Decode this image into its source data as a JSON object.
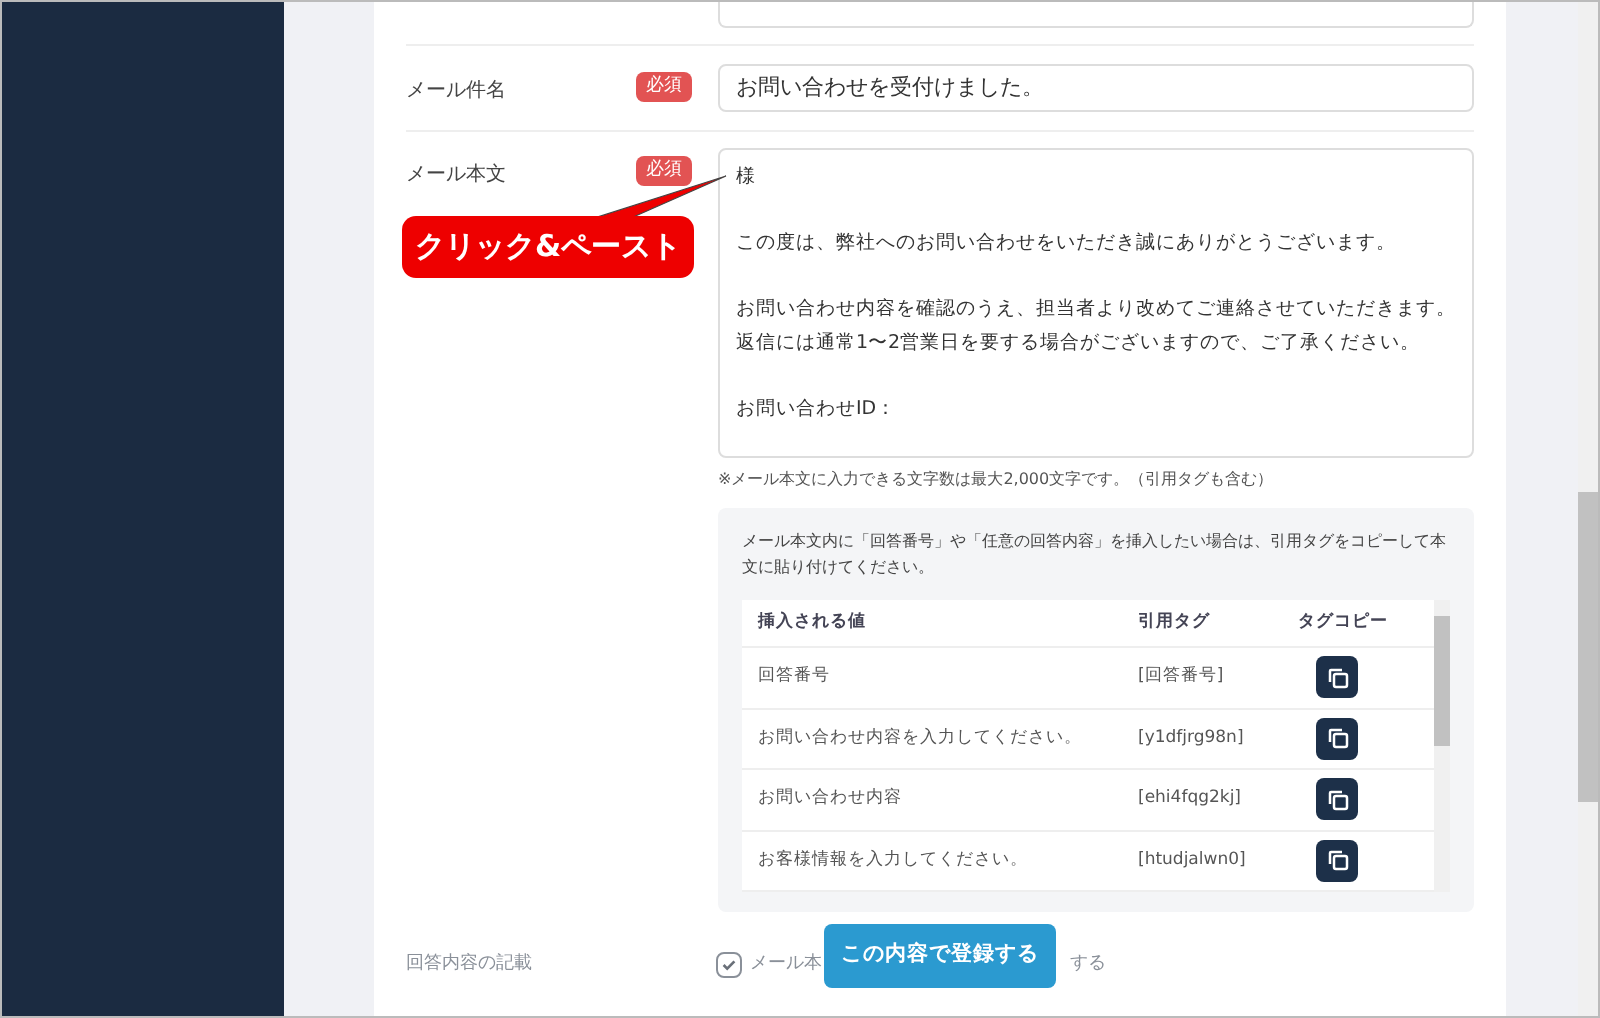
{
  "form": {
    "rows": [
      {
        "label": "メール件名",
        "badge": "必須",
        "kind": "input",
        "value": "お問い合わせを受付けました。"
      },
      {
        "label": "メール本文",
        "badge": "必須",
        "kind": "textarea",
        "paragraphs": [
          [
            "様"
          ],
          [
            "この度は、弊社へのお問い合わせをいただき誠にありがとうございます。"
          ],
          [
            "お問い合わせ内容を確認のうえ、担当者より改めてご連絡させていただきます。",
            "返信には通常1〜2営業日を要する場合がございますので、ご了承ください。"
          ],
          [
            "お問い合わせID："
          ]
        ],
        "note": "※メール本文に入力できる文字数は最大2,000文字です。（引用タグも含む）"
      }
    ]
  },
  "callout": "クリック&ペースト",
  "tag_panel": {
    "description": "メール本文内に「回答番号」や「任意の回答内容」を挿入したい場合は、引用タグをコピーして本文に貼り付けてください。",
    "columns": [
      "挿入される値",
      "引用タグ",
      "タグコピー"
    ],
    "rows": [
      {
        "value": "回答番号",
        "tag": "[回答番号]"
      },
      {
        "value": "お問い合わせ内容を入力してください。",
        "tag": "[y1dfjrg98n]"
      },
      {
        "value": "お問い合わせ内容",
        "tag": "[ehi4fqg2kj]"
      },
      {
        "value": "お客様情報を入力してください。",
        "tag": "[htudjalwn0]"
      }
    ]
  },
  "footer": {
    "label": "回答内容の記載",
    "checkbox": {
      "checked": true,
      "label_start": "メール本",
      "label_end": "する"
    },
    "submit": "この内容で登録する"
  }
}
